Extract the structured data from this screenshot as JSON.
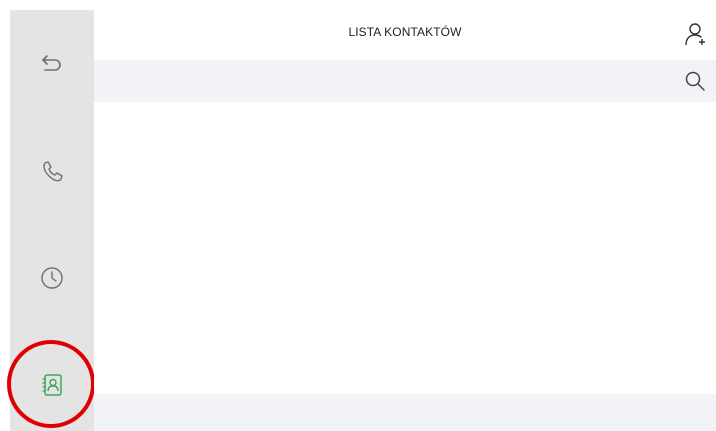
{
  "header": {
    "title": "LISTA KONTAKTÓW",
    "add_contact_icon": "add-user-icon"
  },
  "search": {
    "value": "",
    "placeholder": "",
    "icon": "search-icon"
  },
  "sidebar": {
    "items": [
      {
        "id": "back",
        "icon": "back-arrow-icon",
        "active": false
      },
      {
        "id": "calls",
        "icon": "phone-icon",
        "active": false
      },
      {
        "id": "history",
        "icon": "clock-icon",
        "active": false
      },
      {
        "id": "contacts",
        "icon": "contacts-book-icon",
        "active": true
      }
    ]
  },
  "contacts": [],
  "colors": {
    "sidebar_bg": "#e4e4e4",
    "icon_gray": "#6f6f6f",
    "active_green": "#3fa65a",
    "search_bg": "#f2f3f7",
    "highlight_red": "#e00000"
  }
}
